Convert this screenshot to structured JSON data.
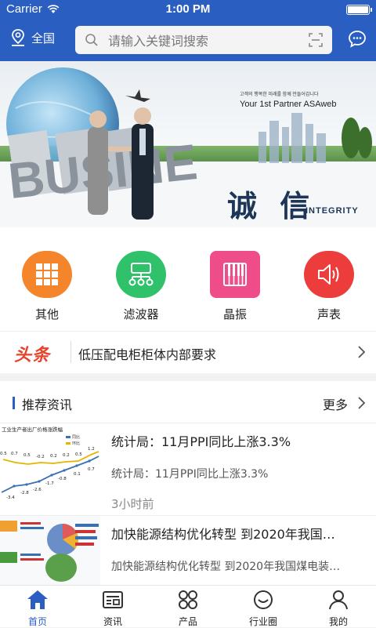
{
  "status_bar": {
    "carrier": "Carrier",
    "time": "1:00 PM"
  },
  "nav": {
    "location": "全国",
    "search_placeholder": "请输入关键词搜索"
  },
  "banner": {
    "word_main": "BUSINESS",
    "slogan": "Your 1st Partner ASAweb",
    "slogan_kr": "고객의 행복한 미래를 함께 만들어갑니다",
    "cn_word": "诚 信",
    "en_word": "INTEGRITY"
  },
  "categories": [
    {
      "label": "其他",
      "icon": "grid-icon",
      "color": "#f5852b"
    },
    {
      "label": "滤波器",
      "icon": "network-icon",
      "color": "#2fc26a"
    },
    {
      "label": "晶振",
      "icon": "piano-icon",
      "color": "#ee4d8a"
    },
    {
      "label": "声表",
      "icon": "speaker-icon",
      "color": "#ec3c3c"
    }
  ],
  "headline": {
    "tag": "头条",
    "text": "低压配电柜柜体内部要求"
  },
  "news": {
    "section_title": "推荐资讯",
    "more_label": "更多",
    "items": [
      {
        "title": "统计局：11月PPI同比上涨3.3%",
        "summary": "统计局：11月PPI同比上涨3.3%",
        "time": "3小时前"
      },
      {
        "title": "加快能源结构优化转型 到2020年我国…",
        "summary": "加快能源结构优化转型 到2020年我国煤电装…",
        "time": ""
      }
    ],
    "chart_thumb": {
      "title": "工业生产者出厂价格涨跌幅",
      "legend": [
        "同比",
        "环比"
      ],
      "top_labels": [
        "0.5",
        "0.7",
        "0.5",
        "-0.2",
        "0.2",
        "0.2",
        "0.5",
        "1.2"
      ],
      "bottom_labels": [
        "-3.4",
        "-2.8",
        "-2.6",
        "-1.7",
        "-0.8",
        "0.1",
        "0.7"
      ]
    }
  },
  "tabs": [
    {
      "label": "首页",
      "icon": "home-icon",
      "active": true
    },
    {
      "label": "资讯",
      "icon": "news-icon",
      "active": false
    },
    {
      "label": "产品",
      "icon": "products-icon",
      "active": false
    },
    {
      "label": "行业圈",
      "icon": "circle-icon",
      "active": false
    },
    {
      "label": "我的",
      "icon": "user-icon",
      "active": false
    }
  ],
  "colors": {
    "primary": "#2a5fc1",
    "headline_red": "#e8422a"
  }
}
